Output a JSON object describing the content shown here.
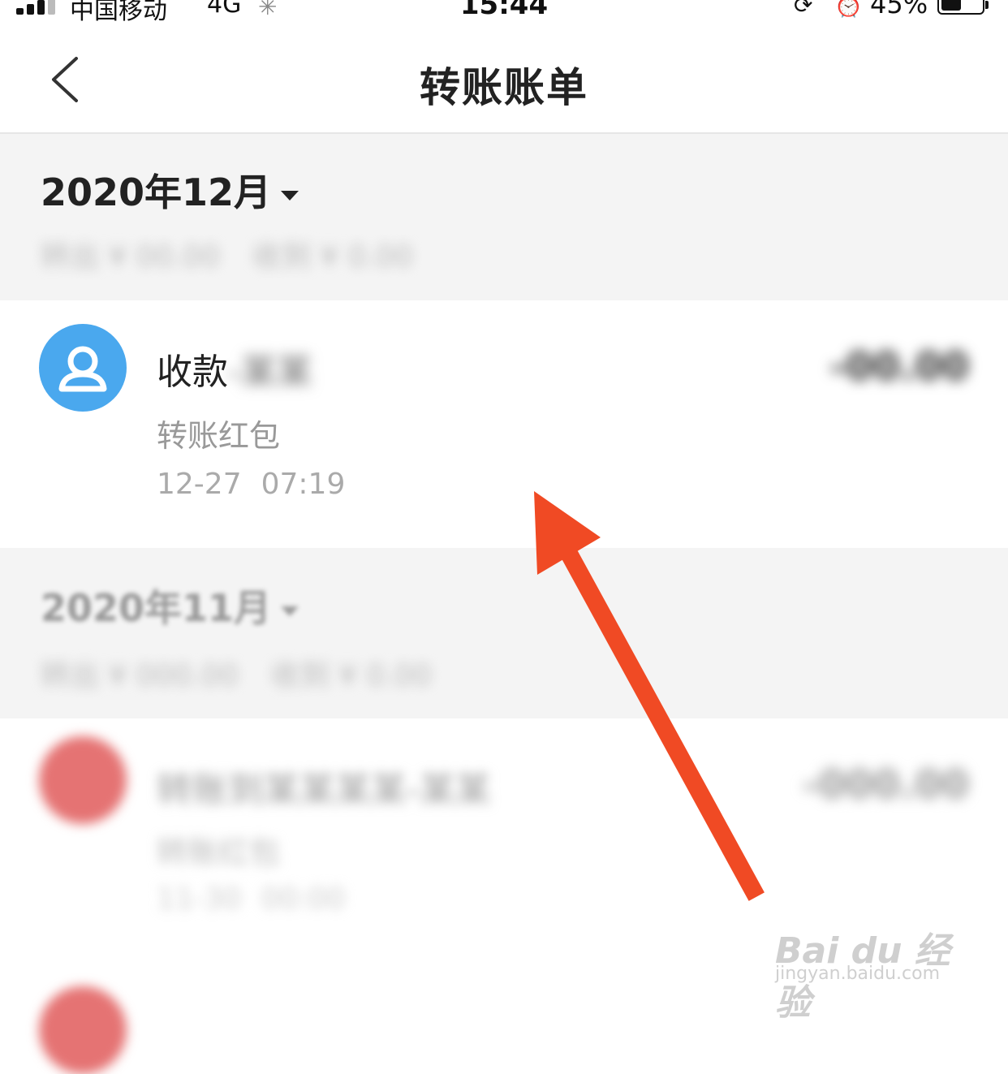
{
  "status_bar": {
    "carrier": "中国移动",
    "network": "4G",
    "time": "15:44",
    "battery": "45%"
  },
  "nav": {
    "title": "转账账单",
    "back_icon": "chevron-left-icon"
  },
  "months": [
    {
      "title": "2020年12月",
      "summary": [
        "转出 ¥ 00.00",
        "收到 ¥ 0.00"
      ],
      "transactions": [
        {
          "title": "收款",
          "title_suffix": "-某某",
          "subtitle": "转账红包",
          "date": "12-27",
          "time": "07:19",
          "amount": "-00.00",
          "avatar_icon": "user-icon",
          "avatar_color": "#4aa8ee"
        }
      ]
    },
    {
      "title": "2020年11月",
      "summary": [
        "转出 ¥ 000.00",
        "收到 ¥ 0.00"
      ],
      "transactions": [
        {
          "title": "转账到某某某某-某某",
          "subtitle": "转账红包",
          "date": "11-30",
          "time": "00:00",
          "amount": "-000.00",
          "avatar_color": "#e57373"
        }
      ]
    }
  ],
  "overlay": {
    "arrow_color": "#f04a24"
  },
  "watermark": {
    "brand": "Bai du 经验",
    "url": "jingyan.baidu.com"
  }
}
